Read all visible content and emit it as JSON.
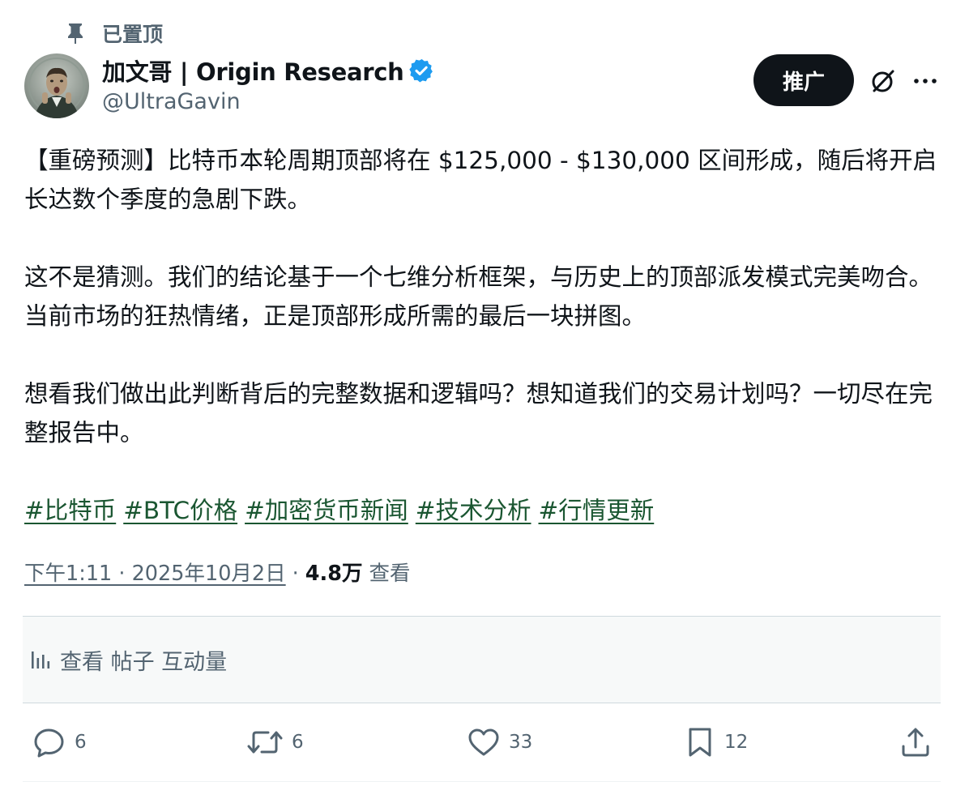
{
  "pinned": {
    "label": "已置顶"
  },
  "author": {
    "display_name": "加文哥 | Origin Research",
    "handle": "@UltraGavin",
    "verified": true
  },
  "header_actions": {
    "promote_label": "推广",
    "grok_icon": "grok-icon",
    "more_icon": "more-icon"
  },
  "tweet": {
    "paragraphs": [
      "【重磅预测】比特币本轮周期顶部将在 $125,000 - $130,000 区间形成，随后将开启长达数个季度的急剧下跌。",
      "这不是猜测。我们的结论基于一个七维分析框架，与历史上的顶部派发模式完美吻合。当前市场的狂热情绪，正是顶部形成所需的最后一块拼图。",
      "想看我们做出此判断背后的完整数据和逻辑吗？想知道我们的交易计划吗？一切尽在完整报告中。"
    ],
    "hashtags": [
      "#比特币",
      "#BTC价格",
      "#加密货币新闻",
      "#技术分析",
      "#行情更新"
    ]
  },
  "meta": {
    "time": "下午1:11 · 2025年10月2日",
    "separator": "·",
    "views_count": "4.8万",
    "views_label": "查看"
  },
  "analytics": {
    "label": "查看 帖子 互动量"
  },
  "actions": {
    "reply_count": "6",
    "retweet_count": "6",
    "like_count": "33",
    "bookmark_count": "12"
  },
  "colors": {
    "text_primary": "#0f1419",
    "text_secondary": "#536471",
    "hashtag": "#1a5631",
    "verified": "#1d9bf0",
    "button_bg": "#0f1419"
  }
}
